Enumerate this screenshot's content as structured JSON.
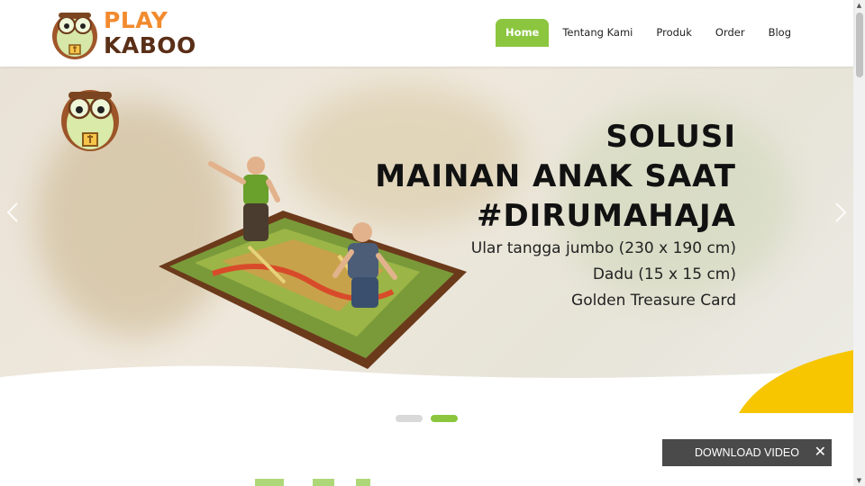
{
  "brand": {
    "logo_line1": "PLAY",
    "logo_line2": "KABOO",
    "primary_color": "#8cc63f",
    "accent_orange": "#f28a2e",
    "accent_brown": "#5a2f17",
    "accent_yellow": "#f7c600"
  },
  "nav": {
    "items": [
      {
        "label": "Home",
        "active": true
      },
      {
        "label": "Tentang Kami",
        "active": false
      },
      {
        "label": "Produk",
        "active": false
      },
      {
        "label": "Order",
        "active": false
      },
      {
        "label": "Blog",
        "active": false
      }
    ]
  },
  "hero": {
    "title_line1": "SOLUSI",
    "title_line2": "MAINAN ANAK SAAT",
    "title_line3": "#DIRUMAHAJA",
    "sub_line1": "Ular tangga jumbo (230 x 190 cm)",
    "sub_line2": "Dadu (15 x 15 cm)",
    "sub_line3": "Golden Treasure Card",
    "prev_icon": "chevron-left-icon",
    "next_icon": "chevron-right-icon"
  },
  "slider": {
    "dots": [
      {
        "active": false
      },
      {
        "active": true
      }
    ]
  },
  "download": {
    "label": "DOWNLOAD VIDEO",
    "close_symbol": "✕"
  }
}
